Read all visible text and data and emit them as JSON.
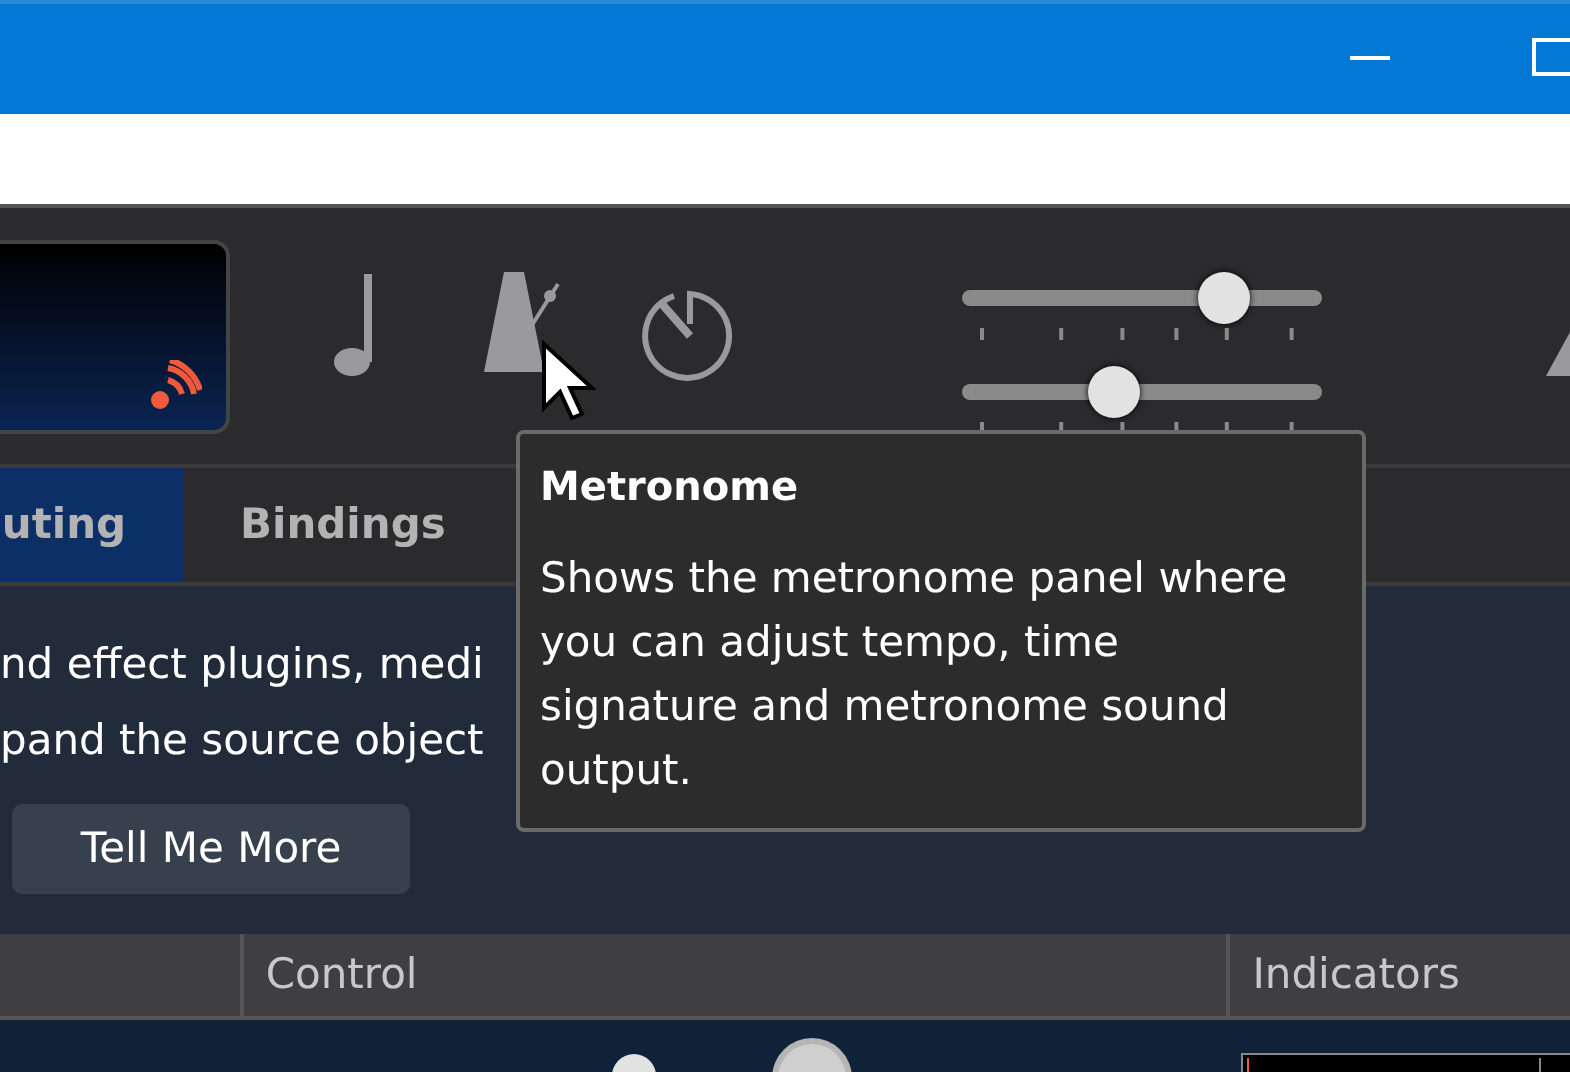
{
  "sliders": [
    {
      "level": 0.73
    },
    {
      "level": 0.42
    }
  ],
  "tabs": [
    {
      "label": "uting",
      "selected": true
    },
    {
      "label": "Bindings",
      "selected": false
    }
  ],
  "info": {
    "lines": [
      "nd effect plugins, medi",
      "pand the source object"
    ],
    "button": "Tell Me More"
  },
  "table": {
    "columns": [
      "Control",
      "Indicators"
    ]
  },
  "tooltip": {
    "title": "Metronome",
    "text": "Shows the metronome panel where you can adjust tempo, time signature and metronome sound output."
  }
}
